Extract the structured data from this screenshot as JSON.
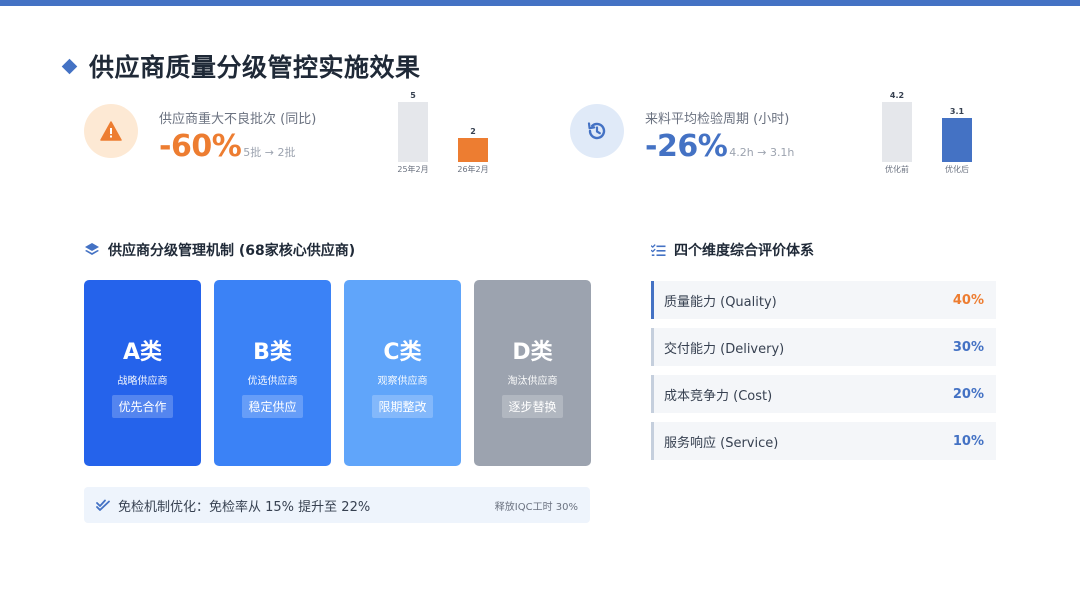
{
  "title": "供应商质量分级管控实施效果",
  "kpi1": {
    "icon": "warning-icon",
    "label": "供应商重大不良批次 (同比)",
    "value": "-60%",
    "sub": "5批 → 2批",
    "chart": {
      "bars": [
        {
          "category": "25年2月",
          "value": 5,
          "label": "5",
          "color": "#e5e7eb"
        },
        {
          "category": "26年2月",
          "value": 2,
          "label": "2",
          "color": "#ed7d31"
        }
      ]
    }
  },
  "kpi2": {
    "icon": "history-icon",
    "label": "来料平均检验周期 (小时)",
    "value": "-26%",
    "sub": "4.2h → 3.1h",
    "chart": {
      "bars": [
        {
          "category": "优化前",
          "value": 4.2,
          "label": "4.2",
          "color": "#e5e7eb"
        },
        {
          "category": "优化后",
          "value": 3.1,
          "label": "3.1",
          "color": "#4472c4"
        }
      ]
    }
  },
  "tiers": {
    "title": "供应商分级管理机制 (68家核心供应商)",
    "items": [
      {
        "name": "A类",
        "desc": "战略供应商",
        "tag": "优先合作"
      },
      {
        "name": "B类",
        "desc": "优选供应商",
        "tag": "稳定供应"
      },
      {
        "name": "C类",
        "desc": "观察供应商",
        "tag": "限期整改"
      },
      {
        "name": "D类",
        "desc": "淘汰供应商",
        "tag": "逐步替换"
      }
    ]
  },
  "exempt": {
    "text": "免检机制优化：免检率从 15% 提升至 22%",
    "note": "释放IQC工时 30%"
  },
  "dimensions": {
    "title": "四个维度综合评价体系",
    "items": [
      {
        "label": "质量能力 (Quality)",
        "pct": "40%",
        "color": "#ed7d31"
      },
      {
        "label": "交付能力 (Delivery)",
        "pct": "30%",
        "color": "#4472c4"
      },
      {
        "label": "成本竞争力 (Cost)",
        "pct": "20%",
        "color": "#4472c4"
      },
      {
        "label": "服务响应 (Service)",
        "pct": "10%",
        "color": "#4472c4"
      }
    ]
  }
}
